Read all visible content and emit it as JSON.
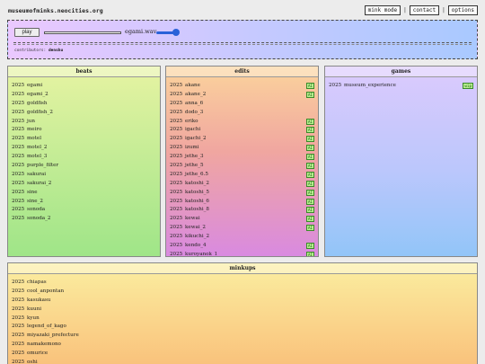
{
  "site": {
    "title": "museumofminks.neocities.org"
  },
  "nav": {
    "mink_mode": "mink mode",
    "contact": "contact",
    "options": "options",
    "sep": "|"
  },
  "player": {
    "play_label": "play",
    "track": "egami.wav",
    "progress": 0,
    "volume": 0.85,
    "contributors_label": "contributors:",
    "contributors_value": "denshu"
  },
  "panels": {
    "beats": {
      "title": "beats",
      "items": [
        {
          "year": "2025",
          "name": "egami"
        },
        {
          "year": "2025",
          "name": "egami_2"
        },
        {
          "year": "2025",
          "name": "goldfish"
        },
        {
          "year": "2025",
          "name": "goldfish_2"
        },
        {
          "year": "2025",
          "name": "jun"
        },
        {
          "year": "2025",
          "name": "meiro"
        },
        {
          "year": "2025",
          "name": "motel"
        },
        {
          "year": "2025",
          "name": "motel_2"
        },
        {
          "year": "2025",
          "name": "motel_3"
        },
        {
          "year": "2025",
          "name": "purple_filter"
        },
        {
          "year": "2025",
          "name": "sakurai"
        },
        {
          "year": "2025",
          "name": "sakurai_2"
        },
        {
          "year": "2025",
          "name": "sine"
        },
        {
          "year": "2025",
          "name": "sine_2"
        },
        {
          "year": "2025",
          "name": "sonoda"
        },
        {
          "year": "2025",
          "name": "sonoda_2"
        }
      ]
    },
    "edits": {
      "title": "edits",
      "items": [
        {
          "year": "2025",
          "name": "akane",
          "badge": "AI"
        },
        {
          "year": "2025",
          "name": "akane_2",
          "badge": "AI"
        },
        {
          "year": "2025",
          "name": "anna_6",
          "badge": ""
        },
        {
          "year": "2025",
          "name": "dodo_3",
          "badge": ""
        },
        {
          "year": "2025",
          "name": "eriko",
          "badge": "AI"
        },
        {
          "year": "2025",
          "name": "igachi",
          "badge": "AI"
        },
        {
          "year": "2025",
          "name": "igachi_2",
          "badge": "AI"
        },
        {
          "year": "2025",
          "name": "izumi",
          "badge": "AI"
        },
        {
          "year": "2025",
          "name": "jethe_3",
          "badge": "AI"
        },
        {
          "year": "2025",
          "name": "jethe_5",
          "badge": "AI"
        },
        {
          "year": "2025",
          "name": "jethe_6.5",
          "badge": "AI"
        },
        {
          "year": "2025",
          "name": "katoshi_2",
          "badge": "AI"
        },
        {
          "year": "2025",
          "name": "katoshi_5",
          "badge": "AI"
        },
        {
          "year": "2025",
          "name": "katoshi_6",
          "badge": "AI"
        },
        {
          "year": "2025",
          "name": "katoshi_8",
          "badge": "AI"
        },
        {
          "year": "2025",
          "name": "kewai",
          "badge": "AI"
        },
        {
          "year": "2025",
          "name": "kewai_2",
          "badge": "AI"
        },
        {
          "year": "2025",
          "name": "kikuchi_2",
          "badge": ""
        },
        {
          "year": "2025",
          "name": "kendo_4",
          "badge": "AI"
        },
        {
          "year": "2025",
          "name": "kuroyanok_1",
          "badge": "AI"
        }
      ]
    },
    "games": {
      "title": "games",
      "items": [
        {
          "year": "2025",
          "name": "museum_experience",
          "badge": "wip"
        }
      ]
    },
    "minkups": {
      "title": "minkups",
      "items": [
        {
          "year": "2025",
          "name": "chiapas"
        },
        {
          "year": "2025",
          "name": "cool_anpontan"
        },
        {
          "year": "2025",
          "name": "kasukasu"
        },
        {
          "year": "2025",
          "name": "kuuni"
        },
        {
          "year": "2025",
          "name": "kyun"
        },
        {
          "year": "2025",
          "name": "legend_of_kago"
        },
        {
          "year": "2025",
          "name": "miyazaki_prefecture"
        },
        {
          "year": "2025",
          "name": "namakemono"
        },
        {
          "year": "2025",
          "name": "omurice"
        },
        {
          "year": "2025",
          "name": "oshi"
        }
      ]
    }
  }
}
